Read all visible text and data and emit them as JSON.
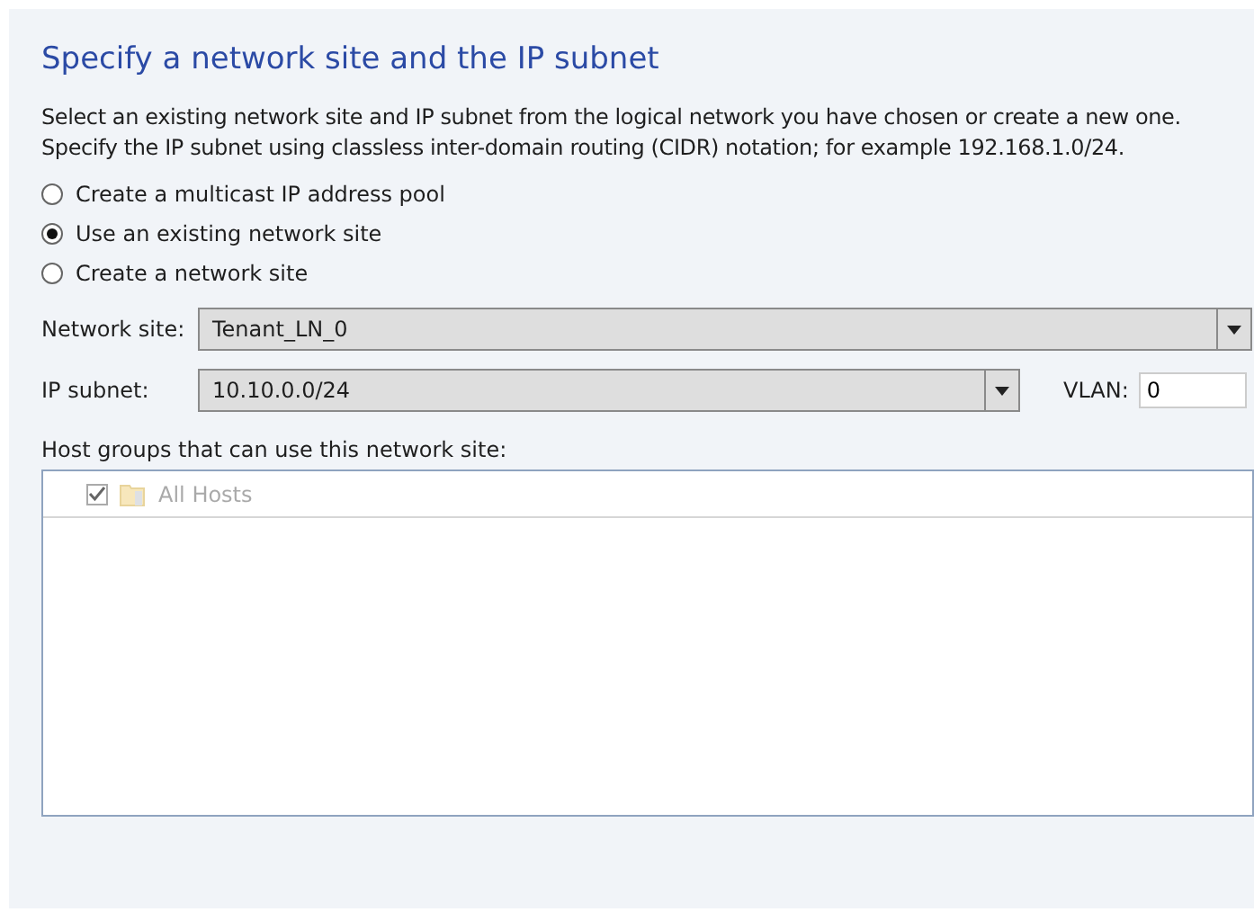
{
  "page": {
    "title": "Specify a network site and the IP subnet",
    "description": "Select an existing network site and IP subnet from the logical network you have chosen or create a new one. Specify the IP subnet using classless inter-domain routing (CIDR) notation; for example 192.168.1.0/24."
  },
  "options": [
    {
      "label": "Create a multicast IP address pool",
      "selected": false
    },
    {
      "label": "Use an existing network site",
      "selected": true
    },
    {
      "label": "Create a network site",
      "selected": false
    }
  ],
  "network_site": {
    "label": "Network site:",
    "value": "Tenant_LN_0"
  },
  "ip_subnet": {
    "label": "IP subnet:",
    "value": "10.10.0.0/24"
  },
  "vlan": {
    "label": "VLAN:",
    "value": "0"
  },
  "host_groups": {
    "label": "Host groups that can use this network site:",
    "items": [
      {
        "label": "All Hosts",
        "checked": true,
        "disabled": true
      }
    ]
  }
}
